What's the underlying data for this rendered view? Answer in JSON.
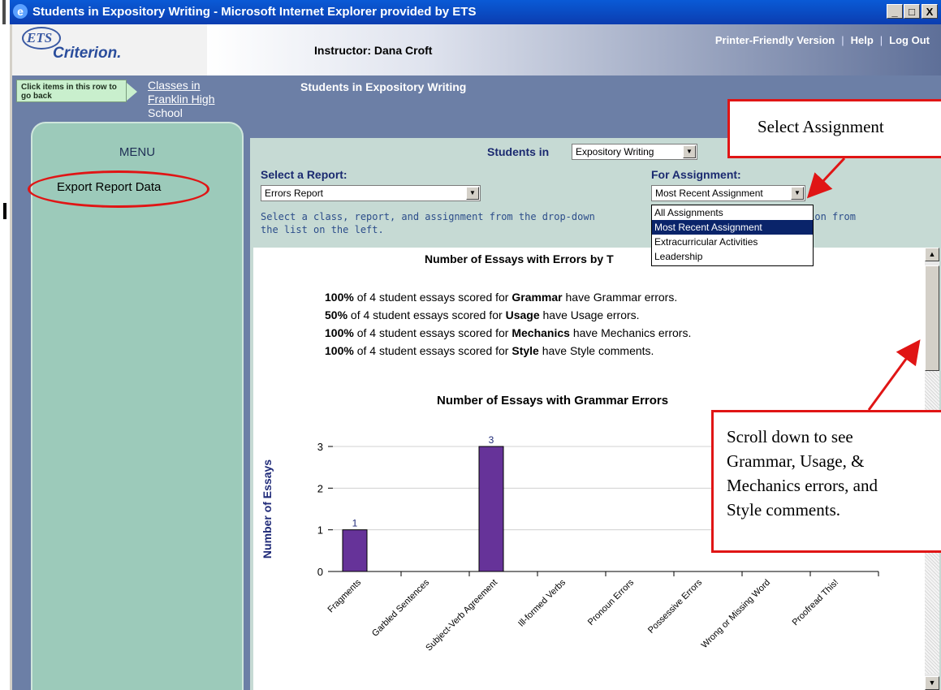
{
  "window": {
    "title": "Students in Expository Writing - Microsoft Internet Explorer provided by ETS",
    "controls": [
      "_",
      "□",
      "X"
    ]
  },
  "header": {
    "logo_ets": "ETS",
    "logo_criterion": "Criterion.",
    "instructor": "Instructor: Dana Croft",
    "links": {
      "printer": "Printer-Friendly Version",
      "help": "Help",
      "logout": "Log Out",
      "separator": "|"
    }
  },
  "breadcrumb": {
    "hint": "Click items in this row to go back",
    "link": "Classes in Franklin High School",
    "current": "Students in Expository Writing"
  },
  "menu": {
    "title": "MENU",
    "items": [
      {
        "label": "Export Report Data"
      }
    ]
  },
  "filters": {
    "students_in_label": "Students in",
    "students_in_value": "Expository Writing",
    "report_label": "Select a Report:",
    "report_value": "Errors Report",
    "assignment_label": "For Assignment:",
    "assignment_value": "Most Recent Assignment",
    "assignment_options": [
      "All Assignments",
      "Most Recent Assignment",
      "Extracurricular Activities",
      "Leadership"
    ],
    "assignment_selected_index": 1,
    "instructions_a": "Select a class, report, and assignment from the drop-down",
    "instructions_b": "rt Option from",
    "instructions_c": "the list on the left."
  },
  "report": {
    "title": "Number of Essays with Errors by T",
    "stats": [
      {
        "pct": "100%",
        "pre": " of 4 student essays scored for ",
        "cat": "Grammar",
        "post": " have Grammar errors."
      },
      {
        "pct": "50%",
        "pre": " of 4 student essays scored for ",
        "cat": "Usage",
        "post": " have Usage errors."
      },
      {
        "pct": "100%",
        "pre": " of 4 student essays scored for ",
        "cat": "Mechanics",
        "post": " have Mechanics errors."
      },
      {
        "pct": "100%",
        "pre": " of 4 student essays scored for ",
        "cat": "Style",
        "post": " have Style comments."
      }
    ]
  },
  "chart_data": {
    "type": "bar",
    "title": "Number of Essays with Grammar Errors",
    "xlabel": "",
    "ylabel": "Number of Essays",
    "categories": [
      "Fragments",
      "Garbled Sentences",
      "Subject-Verb Agreement",
      "Ill-formed Verbs",
      "Pronoun Errors",
      "Possessive Errors",
      "Wrong or Missing Word",
      "Proofread This!"
    ],
    "values": [
      1,
      0,
      3,
      0,
      0,
      0,
      0,
      0
    ],
    "data_labels": [
      "1",
      "",
      "3",
      "",
      "",
      "",
      "",
      ""
    ],
    "yticks": [
      0,
      1,
      2,
      3
    ],
    "ylim": [
      0,
      3
    ],
    "bar_color": "#663399",
    "grid": true
  },
  "callouts": {
    "select_assignment": "Select Assignment",
    "scroll": [
      "Scroll down to see",
      "Grammar, Usage,  &",
      "Mechanics errors, and",
      "Style comments."
    ],
    "color": "#e01515"
  },
  "scrollbar": {
    "up": "▲",
    "down": "▼"
  }
}
